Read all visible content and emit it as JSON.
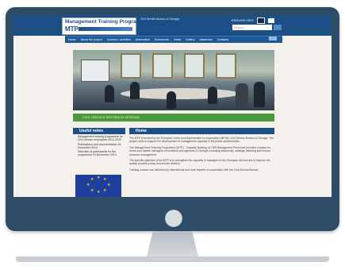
{
  "site": {
    "logo_title": "Management Training Programme",
    "logo_abbr": "MTP",
    "header_org": "Civil Service Bureau of Georgia",
    "search_placeholder": "Search",
    "lang_label": "ENGLISH GEO",
    "nav": [
      "Home",
      "About the project",
      "Courses / activities",
      "Information",
      "Documents",
      "News",
      "Gallery",
      "Vacancies",
      "Contacts"
    ],
    "banner_text": "CIVIL SERVICE REFORM IN GEORGIA",
    "sidebar": {
      "title": "Useful notes",
      "items": [
        "Management training programme for Civil Service employees 2014-2015",
        "Publications and documentation 16 December 2014",
        "Selection of participants for the programme 16 December 2014"
      ]
    },
    "main": {
      "title": "Home",
      "paragraphs": [
        "The MTP is funded by the European Union and implemented in cooperation with the Civil Service Bureau of Georgia. The project aims to support the development of management capacity in the public administration.",
        "The Management Training Programme (MTP) - Capacity Building of CSB Management Personnel provides courses for senior and middle managers of ministries and agencies in Georgia, including leadership, strategic planning and human resource management.",
        "The specific objective of the MTP is to strengthen the capacity of managers in the Georgian civil service to improve the quality of public policy and service delivery.",
        "Training courses are delivered by international and local experts in cooperation with the Civil Service Bureau."
      ]
    }
  },
  "colors": {
    "bezel": "#2e4c65",
    "header": "#1b4f86",
    "banner": "#4a9a3c"
  },
  "icons": [
    "power-button-icon",
    "search-icon",
    "eu-flag-icon"
  ]
}
